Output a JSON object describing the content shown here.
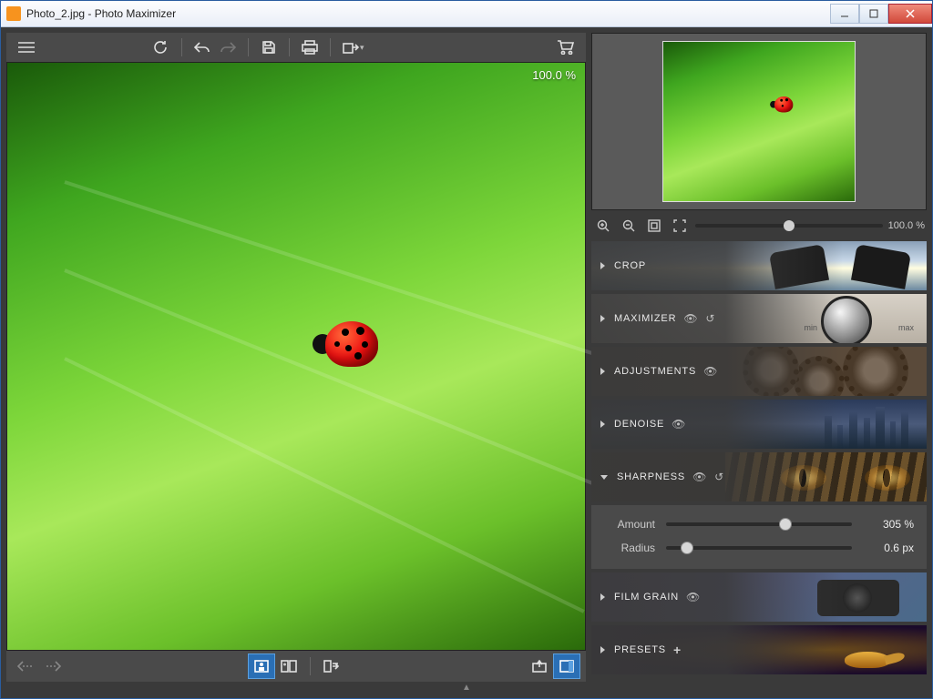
{
  "window": {
    "title": "Photo_2.jpg - Photo Maximizer"
  },
  "canvas": {
    "zoom_label": "100.0 %"
  },
  "preview": {
    "zoom_label": "100.0 %",
    "slider_percent": 50
  },
  "panels": {
    "crop": {
      "label": "CROP"
    },
    "maximizer": {
      "label": "MAXIMIZER",
      "min": "min",
      "max": "max"
    },
    "adjustments": {
      "label": "ADJUSTMENTS"
    },
    "denoise": {
      "label": "DENOISE"
    },
    "sharpness": {
      "label": "SHARPNESS",
      "amount": {
        "label": "Amount",
        "value": 305,
        "unit": "%",
        "display": "305 %",
        "percent": 61
      },
      "radius": {
        "label": "Radius",
        "value": 0.6,
        "unit": "px",
        "display": "0.6 px",
        "percent": 8
      }
    },
    "filmgrain": {
      "label": "FILM GRAIN"
    },
    "presets": {
      "label": "PRESETS"
    }
  }
}
